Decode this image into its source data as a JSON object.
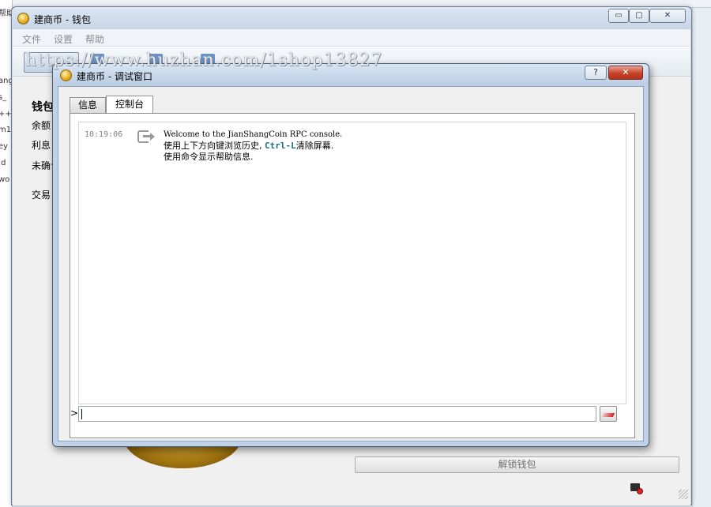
{
  "background": {
    "left_fragments": [
      "帮助",
      "ang",
      "s_",
      "++ 0",
      "m1",
      "ey",
      ".d",
      "wo"
    ]
  },
  "main_window": {
    "title": "建商币 - 钱包",
    "caption_buttons": {
      "minimize": "▭",
      "maximize": "▢",
      "close": "✕"
    },
    "menu": {
      "file": "文件",
      "settings": "设置",
      "help": "帮助"
    },
    "wallet": {
      "heading": "钱包",
      "balance_label": "余额：",
      "interest_label": "利息：",
      "unconfirmed_label": "未确认：",
      "transactions_label": "交易："
    },
    "unlock_button": "解锁钱包"
  },
  "overlay": {
    "link_text": "https://www.huzhan.com/1shop13827"
  },
  "debug_window": {
    "title": "建商币 - 调试窗口",
    "help_button": "?",
    "close_button": "✕",
    "tabs": [
      {
        "label": "信息",
        "active": false
      },
      {
        "label": "控制台",
        "active": true
      }
    ],
    "console": {
      "timestamp": "10:19:06",
      "line1": "Welcome to the JianShangCoin RPC console.",
      "line2_before": "使用上下方向键浏览历史, ",
      "line2_key": "Ctrl-L",
      "line2_after": "清除屏幕.",
      "line3": "使用命令显示帮助信息.",
      "prompt": ">",
      "input_value": ""
    }
  },
  "colors": {
    "title_bar": "#c6d5e6",
    "close_red": "#c64128",
    "key_highlight": "#1c6f80"
  }
}
